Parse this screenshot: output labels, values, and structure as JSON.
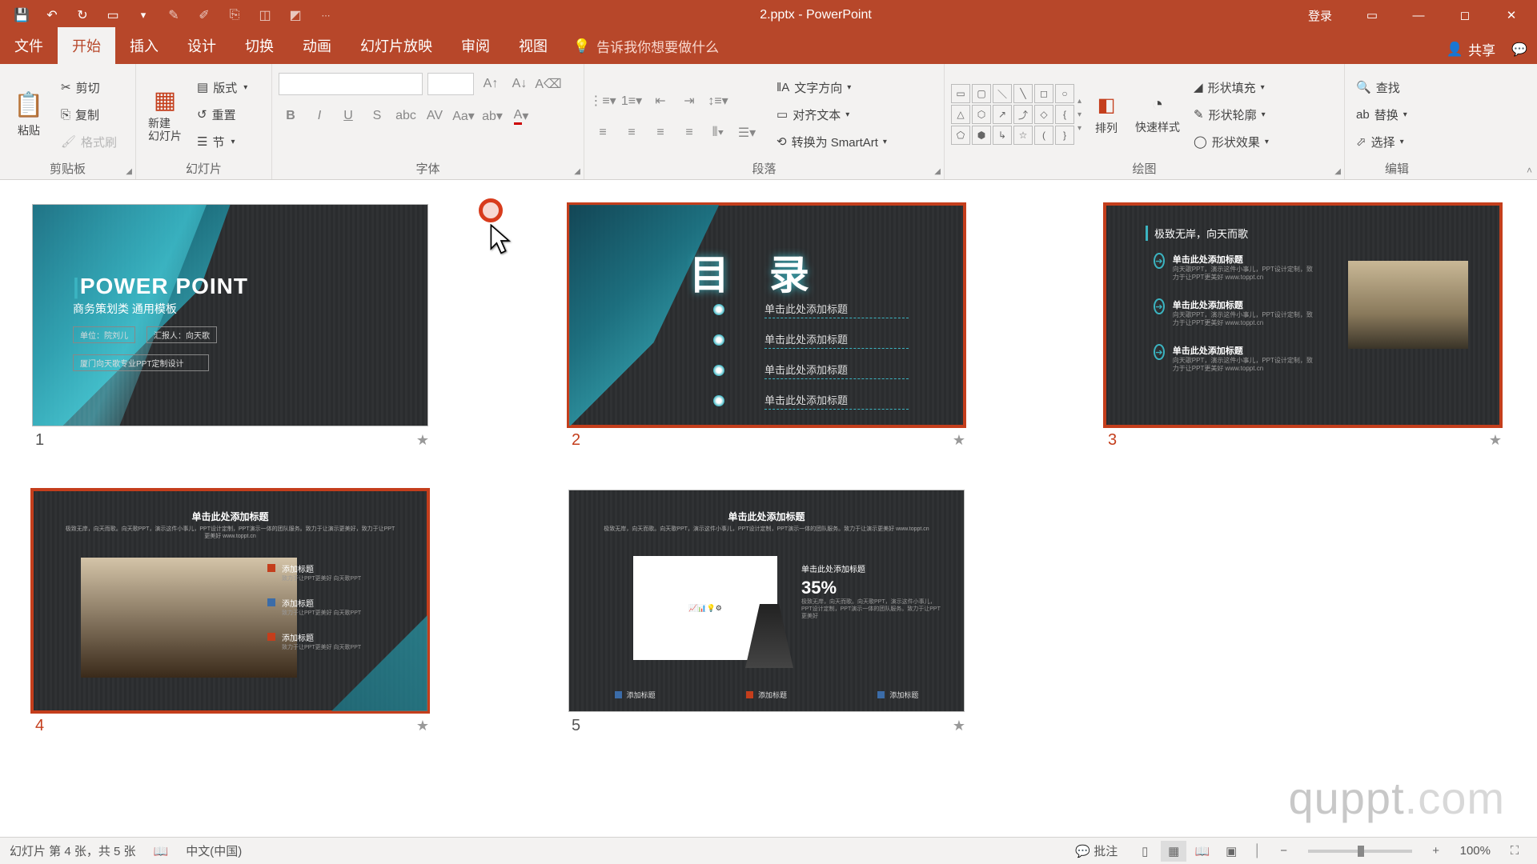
{
  "titlebar": {
    "doc_title": "2.pptx - PowerPoint",
    "login": "登录"
  },
  "tabs": {
    "file": "文件",
    "home": "开始",
    "insert": "插入",
    "design": "设计",
    "transitions": "切换",
    "animations": "动画",
    "slideshow": "幻灯片放映",
    "review": "审阅",
    "view": "视图",
    "tell_me": "告诉我你想要做什么",
    "share": "共享"
  },
  "ribbon": {
    "clipboard": {
      "label": "剪贴板",
      "paste": "粘贴",
      "cut": "剪切",
      "copy": "复制",
      "format_painter": "格式刷"
    },
    "slides": {
      "label": "幻灯片",
      "new_slide": "新建\n幻灯片",
      "layout": "版式",
      "reset": "重置",
      "section": "节"
    },
    "font": {
      "label": "字体"
    },
    "paragraph": {
      "label": "段落",
      "text_dir": "文字方向",
      "align_text": "对齐文本",
      "convert_smartart": "转换为 SmartArt"
    },
    "drawing": {
      "label": "绘图",
      "arrange": "排列",
      "quick_styles": "快速样式",
      "shape_fill": "形状填充",
      "shape_outline": "形状轮廓",
      "shape_effects": "形状效果"
    },
    "editing": {
      "label": "编辑",
      "find": "查找",
      "replace": "替换",
      "select": "选择"
    }
  },
  "slides_content": {
    "s1": {
      "title_prefix": "|",
      "title": "POWER POINT",
      "subtitle": "商务策划类 通用模板",
      "box1": "单位：院刘儿",
      "box2": "汇报人：向天歌",
      "box3": "厦门向天歌专业PPT定制设计"
    },
    "s2": {
      "title": "目 录",
      "items": [
        "单击此处添加标题",
        "单击此处添加标题",
        "单击此处添加标题",
        "单击此处添加标题"
      ]
    },
    "s3": {
      "header": "极致无岸，向天而歌",
      "item_title": "单击此处添加标题",
      "item_desc": "向天歌PPT，演示这件小事儿，PPT设计定制，致力于让PPT更美好 www.toppt.cn"
    },
    "s4": {
      "header": "单击此处添加标题",
      "sub": "极致无岸，向天而歌。向天歌PPT，演示这件小事儿，PPT设计定制，PPT演示一体的团队服务。致力于让演示更美好，致力于让PPT更美好 www.toppt.cn",
      "item_title": "添加标题",
      "item_desc": "致力于让PPT更美好 向天歌PPT"
    },
    "s5": {
      "header": "单击此处添加标题",
      "sub": "极致无岸，向天而歌。向天歌PPT，演示这件小事儿，PPT设计定制，PPT演示一体的团队服务。致力于让演示更美好 www.toppt.cn",
      "right_title": "单击此处添加标题",
      "pct": "35%",
      "right_desc": "极致无岸，向天而歌。向天歌PPT，演示这件小事儿，PPT设计定制，PPT演示一体的团队服务。致力于让PPT更美好",
      "bottom": "添加标题"
    },
    "numbers": [
      "1",
      "2",
      "3",
      "4",
      "5"
    ]
  },
  "watermark": {
    "brand": "quppt",
    "tld": ".com"
  },
  "status": {
    "slide_info": "幻灯片 第 4 张，共 5 张",
    "lang": "中文(中国)",
    "comments": "批注",
    "zoom": "100%"
  }
}
